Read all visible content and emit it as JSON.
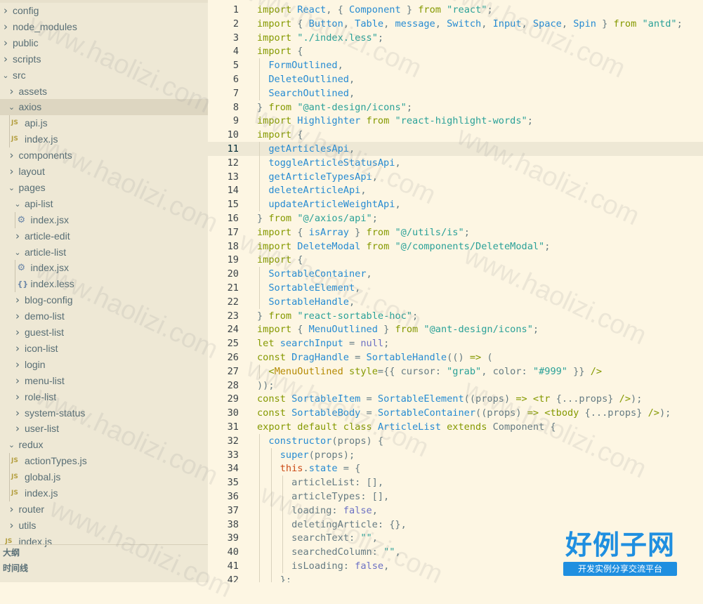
{
  "colors": {
    "sidebar_bg": "#eee8d5",
    "editor_bg": "#fdf6e3",
    "selected_row": "#ddd6c1",
    "keyword": "#859900",
    "identifier": "#268bd2",
    "string": "#2aa198",
    "logo": "#1f8fe0"
  },
  "explorer": {
    "items": [
      {
        "label": "config",
        "kind": "folder",
        "expanded": false
      },
      {
        "label": "node_modules",
        "kind": "folder",
        "expanded": false
      },
      {
        "label": "public",
        "kind": "folder",
        "expanded": false
      },
      {
        "label": "scripts",
        "kind": "folder",
        "expanded": false
      },
      {
        "label": "src",
        "kind": "folder",
        "expanded": true
      },
      {
        "label": "assets",
        "kind": "folder",
        "expanded": false
      },
      {
        "label": "axios",
        "kind": "folder",
        "expanded": true,
        "selected": true
      },
      {
        "label": "api.js",
        "kind": "js",
        "icon": "JS"
      },
      {
        "label": "index.js",
        "kind": "js",
        "icon": "JS"
      },
      {
        "label": "components",
        "kind": "folder",
        "expanded": false
      },
      {
        "label": "layout",
        "kind": "folder",
        "expanded": false
      },
      {
        "label": "pages",
        "kind": "folder",
        "expanded": true
      },
      {
        "label": "api-list",
        "kind": "folder",
        "expanded": true
      },
      {
        "label": "index.jsx",
        "kind": "jsx",
        "icon": "⚙"
      },
      {
        "label": "article-edit",
        "kind": "folder",
        "expanded": false
      },
      {
        "label": "article-list",
        "kind": "folder",
        "expanded": true
      },
      {
        "label": "index.jsx",
        "kind": "jsx",
        "icon": "⚙"
      },
      {
        "label": "index.less",
        "kind": "less",
        "icon": "{}"
      },
      {
        "label": "blog-config",
        "kind": "folder",
        "expanded": false
      },
      {
        "label": "demo-list",
        "kind": "folder",
        "expanded": false
      },
      {
        "label": "guest-list",
        "kind": "folder",
        "expanded": false
      },
      {
        "label": "icon-list",
        "kind": "folder",
        "expanded": false
      },
      {
        "label": "login",
        "kind": "folder",
        "expanded": false
      },
      {
        "label": "menu-list",
        "kind": "folder",
        "expanded": false
      },
      {
        "label": "role-list",
        "kind": "folder",
        "expanded": false
      },
      {
        "label": "system-status",
        "kind": "folder",
        "expanded": false
      },
      {
        "label": "user-list",
        "kind": "folder",
        "expanded": false
      },
      {
        "label": "redux",
        "kind": "folder",
        "expanded": true
      },
      {
        "label": "actionTypes.js",
        "kind": "js",
        "icon": "JS"
      },
      {
        "label": "global.js",
        "kind": "js",
        "icon": "JS"
      },
      {
        "label": "index.js",
        "kind": "js",
        "icon": "JS"
      },
      {
        "label": "router",
        "kind": "folder",
        "expanded": false
      },
      {
        "label": "utils",
        "kind": "folder",
        "expanded": false
      },
      {
        "label": "index.js",
        "kind": "js",
        "icon": "JS"
      }
    ],
    "outline_label": "大纲",
    "timeline_label": "时间线"
  },
  "editor": {
    "current_line": 11,
    "lines": [
      {
        "n": "1",
        "tokens": [
          [
            "kw",
            "import"
          ],
          [
            "p",
            " "
          ],
          [
            "id",
            "React"
          ],
          [
            "p",
            ", { "
          ],
          [
            "id",
            "Component"
          ],
          [
            "p",
            " } "
          ],
          [
            "kw",
            "from"
          ],
          [
            "p",
            " "
          ],
          [
            "str",
            "\"react\""
          ],
          [
            "p",
            ";"
          ]
        ]
      },
      {
        "n": "2",
        "tokens": [
          [
            "kw",
            "import"
          ],
          [
            "p",
            " { "
          ],
          [
            "id",
            "Button"
          ],
          [
            "p",
            ", "
          ],
          [
            "id",
            "Table"
          ],
          [
            "p",
            ", "
          ],
          [
            "id",
            "message"
          ],
          [
            "p",
            ", "
          ],
          [
            "id",
            "Switch"
          ],
          [
            "p",
            ", "
          ],
          [
            "id",
            "Input"
          ],
          [
            "p",
            ", "
          ],
          [
            "id",
            "Space"
          ],
          [
            "p",
            ", "
          ],
          [
            "id",
            "Spin"
          ],
          [
            "p",
            " } "
          ],
          [
            "kw",
            "from"
          ],
          [
            "p",
            " "
          ],
          [
            "str",
            "\"antd\""
          ],
          [
            "p",
            ";"
          ]
        ]
      },
      {
        "n": "3",
        "tokens": [
          [
            "kw",
            "import"
          ],
          [
            "p",
            " "
          ],
          [
            "str",
            "\"./index.less\""
          ],
          [
            "p",
            ";"
          ]
        ]
      },
      {
        "n": "4",
        "tokens": [
          [
            "kw",
            "import"
          ],
          [
            "p",
            " {"
          ]
        ]
      },
      {
        "n": "5",
        "tokens": [
          [
            "p",
            "  "
          ],
          [
            "id",
            "FormOutlined"
          ],
          [
            "p",
            ","
          ]
        ]
      },
      {
        "n": "6",
        "tokens": [
          [
            "p",
            "  "
          ],
          [
            "id",
            "DeleteOutlined"
          ],
          [
            "p",
            ","
          ]
        ]
      },
      {
        "n": "7",
        "tokens": [
          [
            "p",
            "  "
          ],
          [
            "id",
            "SearchOutlined"
          ],
          [
            "p",
            ","
          ]
        ]
      },
      {
        "n": "8",
        "tokens": [
          [
            "p",
            "} "
          ],
          [
            "kw",
            "from"
          ],
          [
            "p",
            " "
          ],
          [
            "str",
            "\"@ant-design/icons\""
          ],
          [
            "p",
            ";"
          ]
        ]
      },
      {
        "n": "9",
        "tokens": [
          [
            "kw",
            "import"
          ],
          [
            "p",
            " "
          ],
          [
            "id",
            "Highlighter"
          ],
          [
            "p",
            " "
          ],
          [
            "kw",
            "from"
          ],
          [
            "p",
            " "
          ],
          [
            "str",
            "\"react-highlight-words\""
          ],
          [
            "p",
            ";"
          ]
        ]
      },
      {
        "n": "10",
        "tokens": [
          [
            "kw",
            "import"
          ],
          [
            "p",
            " {"
          ]
        ]
      },
      {
        "n": "11",
        "tokens": [
          [
            "p",
            "  "
          ],
          [
            "id",
            "getArticlesApi"
          ],
          [
            "p",
            ","
          ]
        ]
      },
      {
        "n": "12",
        "tokens": [
          [
            "p",
            "  "
          ],
          [
            "id",
            "toggleArticleStatusApi"
          ],
          [
            "p",
            ","
          ]
        ]
      },
      {
        "n": "13",
        "tokens": [
          [
            "p",
            "  "
          ],
          [
            "id",
            "getArticleTypesApi"
          ],
          [
            "p",
            ","
          ]
        ]
      },
      {
        "n": "14",
        "tokens": [
          [
            "p",
            "  "
          ],
          [
            "id",
            "deleteArticleApi"
          ],
          [
            "p",
            ","
          ]
        ]
      },
      {
        "n": "15",
        "tokens": [
          [
            "p",
            "  "
          ],
          [
            "id",
            "updateArticleWeightApi"
          ],
          [
            "p",
            ","
          ]
        ]
      },
      {
        "n": "16",
        "tokens": [
          [
            "p",
            "} "
          ],
          [
            "kw",
            "from"
          ],
          [
            "p",
            " "
          ],
          [
            "str",
            "\"@/axios/api\""
          ],
          [
            "p",
            ";"
          ]
        ]
      },
      {
        "n": "17",
        "tokens": [
          [
            "kw",
            "import"
          ],
          [
            "p",
            " { "
          ],
          [
            "id",
            "isArray"
          ],
          [
            "p",
            " } "
          ],
          [
            "kw",
            "from"
          ],
          [
            "p",
            " "
          ],
          [
            "str",
            "\"@/utils/is\""
          ],
          [
            "p",
            ";"
          ]
        ]
      },
      {
        "n": "18",
        "tokens": [
          [
            "kw",
            "import"
          ],
          [
            "p",
            " "
          ],
          [
            "id",
            "DeleteModal"
          ],
          [
            "p",
            " "
          ],
          [
            "kw",
            "from"
          ],
          [
            "p",
            " "
          ],
          [
            "str",
            "\"@/components/DeleteModal\""
          ],
          [
            "p",
            ";"
          ]
        ]
      },
      {
        "n": "19",
        "tokens": [
          [
            "kw",
            "import"
          ],
          [
            "p",
            " {"
          ]
        ]
      },
      {
        "n": "20",
        "tokens": [
          [
            "p",
            "  "
          ],
          [
            "id",
            "SortableContainer"
          ],
          [
            "p",
            ","
          ]
        ]
      },
      {
        "n": "21",
        "tokens": [
          [
            "p",
            "  "
          ],
          [
            "id",
            "SortableElement"
          ],
          [
            "p",
            ","
          ]
        ]
      },
      {
        "n": "22",
        "tokens": [
          [
            "p",
            "  "
          ],
          [
            "id",
            "SortableHandle"
          ],
          [
            "p",
            ","
          ]
        ]
      },
      {
        "n": "23",
        "tokens": [
          [
            "p",
            "} "
          ],
          [
            "kw",
            "from"
          ],
          [
            "p",
            " "
          ],
          [
            "str",
            "\"react-sortable-hoc\""
          ],
          [
            "p",
            ";"
          ]
        ]
      },
      {
        "n": "24",
        "tokens": [
          [
            "kw",
            "import"
          ],
          [
            "p",
            " { "
          ],
          [
            "id",
            "MenuOutlined"
          ],
          [
            "p",
            " } "
          ],
          [
            "kw",
            "from"
          ],
          [
            "p",
            " "
          ],
          [
            "str",
            "\"@ant-design/icons\""
          ],
          [
            "p",
            ";"
          ]
        ]
      },
      {
        "n": "25",
        "tokens": [
          [
            "kw",
            "let"
          ],
          [
            "p",
            " "
          ],
          [
            "id",
            "searchInput"
          ],
          [
            "p",
            " = "
          ],
          [
            "n",
            "null"
          ],
          [
            "p",
            ";"
          ]
        ]
      },
      {
        "n": "26",
        "tokens": [
          [
            "kw",
            "const"
          ],
          [
            "p",
            " "
          ],
          [
            "id",
            "DragHandle"
          ],
          [
            "p",
            " = "
          ],
          [
            "id",
            "SortableHandle"
          ],
          [
            "p",
            "(() "
          ],
          [
            "kw",
            "=>"
          ],
          [
            "p",
            " ("
          ]
        ]
      },
      {
        "n": "27",
        "tokens": [
          [
            "p",
            "  "
          ],
          [
            "kw",
            "<"
          ],
          [
            "cls",
            "MenuOutlined"
          ],
          [
            "p",
            " "
          ],
          [
            "kw",
            "style"
          ],
          [
            "p",
            "={{ cursor: "
          ],
          [
            "str",
            "\"grab\""
          ],
          [
            "p",
            ", color: "
          ],
          [
            "str",
            "\"#999\""
          ],
          [
            "p",
            " }} "
          ],
          [
            "kw",
            "/>"
          ]
        ]
      },
      {
        "n": "28",
        "tokens": [
          [
            "p",
            "));"
          ]
        ]
      },
      {
        "n": "29",
        "tokens": [
          [
            "kw",
            "const"
          ],
          [
            "p",
            " "
          ],
          [
            "id",
            "SortableItem"
          ],
          [
            "p",
            " = "
          ],
          [
            "id",
            "SortableElement"
          ],
          [
            "p",
            "((props) "
          ],
          [
            "kw",
            "=>"
          ],
          [
            "p",
            " "
          ],
          [
            "kw",
            "<tr"
          ],
          [
            "p",
            " {...props} "
          ],
          [
            "kw",
            "/>"
          ],
          [
            "p",
            ");"
          ]
        ]
      },
      {
        "n": "30",
        "tokens": [
          [
            "kw",
            "const"
          ],
          [
            "p",
            " "
          ],
          [
            "id",
            "SortableBody"
          ],
          [
            "p",
            " = "
          ],
          [
            "id",
            "SortableContainer"
          ],
          [
            "p",
            "((props) "
          ],
          [
            "kw",
            "=>"
          ],
          [
            "p",
            " "
          ],
          [
            "kw",
            "<tbody"
          ],
          [
            "p",
            " {...props} "
          ],
          [
            "kw",
            "/>"
          ],
          [
            "p",
            ");"
          ]
        ]
      },
      {
        "n": "31",
        "tokens": [
          [
            "kw",
            "export default class"
          ],
          [
            "p",
            " "
          ],
          [
            "id",
            "ArticleList"
          ],
          [
            "p",
            " "
          ],
          [
            "kw",
            "extends"
          ],
          [
            "p",
            " Component {"
          ]
        ]
      },
      {
        "n": "32",
        "tokens": [
          [
            "p",
            "  "
          ],
          [
            "id",
            "constructor"
          ],
          [
            "p",
            "(props) {"
          ]
        ]
      },
      {
        "n": "33",
        "tokens": [
          [
            "p",
            "    "
          ],
          [
            "id",
            "super"
          ],
          [
            "p",
            "(props);"
          ]
        ]
      },
      {
        "n": "34",
        "tokens": [
          [
            "p",
            "    "
          ],
          [
            "this",
            "this"
          ],
          [
            "p",
            "."
          ],
          [
            "id",
            "state"
          ],
          [
            "p",
            " = {"
          ]
        ]
      },
      {
        "n": "35",
        "tokens": [
          [
            "p",
            "      articleList: [],"
          ]
        ]
      },
      {
        "n": "36",
        "tokens": [
          [
            "p",
            "      articleTypes: [],"
          ]
        ]
      },
      {
        "n": "37",
        "tokens": [
          [
            "p",
            "      loading: "
          ],
          [
            "n",
            "false"
          ],
          [
            "p",
            ","
          ]
        ]
      },
      {
        "n": "38",
        "tokens": [
          [
            "p",
            "      deletingArticle: {},"
          ]
        ]
      },
      {
        "n": "39",
        "tokens": [
          [
            "p",
            "      searchText: "
          ],
          [
            "str",
            "\"\""
          ],
          [
            "p",
            ","
          ]
        ]
      },
      {
        "n": "40",
        "tokens": [
          [
            "p",
            "      searchedColumn: "
          ],
          [
            "str",
            "\"\""
          ],
          [
            "p",
            ","
          ]
        ]
      },
      {
        "n": "41",
        "tokens": [
          [
            "p",
            "      isLoading: "
          ],
          [
            "n",
            "false"
          ],
          [
            "p",
            ","
          ]
        ]
      },
      {
        "n": "42",
        "tokens": [
          [
            "p",
            "    };"
          ]
        ]
      }
    ]
  },
  "watermark": {
    "text": "www.haolizi.com",
    "logo_title": "好例子网",
    "logo_subtitle": "开发实例分享交流平台"
  }
}
